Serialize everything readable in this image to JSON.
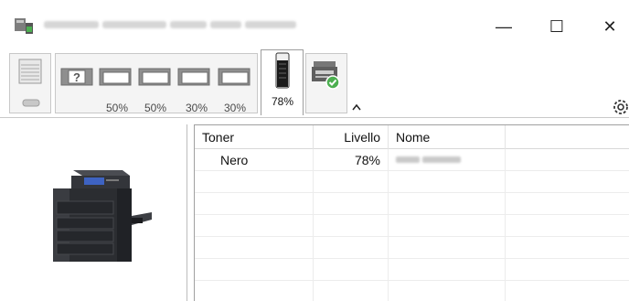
{
  "window": {
    "minimize_glyph": "—",
    "maximize_glyph": "☐",
    "close_glyph": "✕"
  },
  "toolbar": {
    "trays": [
      {
        "icon": "paper-tray-icon",
        "level": "50%"
      },
      {
        "icon": "paper-tray-icon",
        "level": "50%"
      },
      {
        "icon": "paper-tray-icon",
        "level": "30%"
      },
      {
        "icon": "paper-tray-icon",
        "level": "30%"
      }
    ],
    "toner_level": "78%",
    "icons": {
      "stack": "paper-stack-icon",
      "unknown": "unknown-tray-icon",
      "toner": "toner-cartridge-icon",
      "device": "device-status-icon",
      "collapse": "collapse-up-icon",
      "settings": "gear-icon"
    }
  },
  "table": {
    "headers": {
      "toner": "Toner",
      "livello": "Livello",
      "nome": "Nome"
    },
    "rows": [
      {
        "toner": "Nero",
        "livello": "78%"
      }
    ]
  },
  "colors": {
    "toner_fill": "#1a1a1a",
    "status_ok": "#4caf50",
    "printer_body": "#2b2d31"
  }
}
